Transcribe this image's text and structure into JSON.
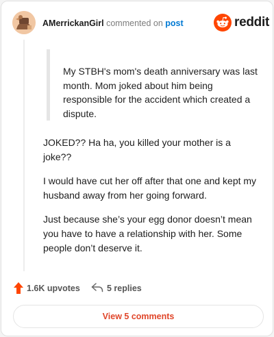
{
  "header": {
    "username": "AMerrickanGirl",
    "action_text": "commented on",
    "post_link": "post",
    "brand": "reddit"
  },
  "comment": {
    "quote": "My STBH's mom's death anniversary was last month. Mom joked about him being responsible for the accident which created a dispute.",
    "paragraphs": [
      "JOKED?? Ha ha, you killed your mother is a joke??",
      "I would have cut her off after that one and kept my husband away from her going forward.",
      "Just because she’s your egg donor doesn’t mean you have to have a relationship with her. Some people don’t deserve it."
    ]
  },
  "actions": {
    "upvotes": "1.6K upvotes",
    "replies": "5 replies",
    "view_comments": "View 5 comments"
  },
  "colors": {
    "brand_orange": "#ff4500",
    "link_blue": "#0079d3",
    "button_text": "#e0462a"
  },
  "icons": [
    "avatar",
    "reddit-logo-icon",
    "upvote-icon",
    "reply-icon"
  ]
}
